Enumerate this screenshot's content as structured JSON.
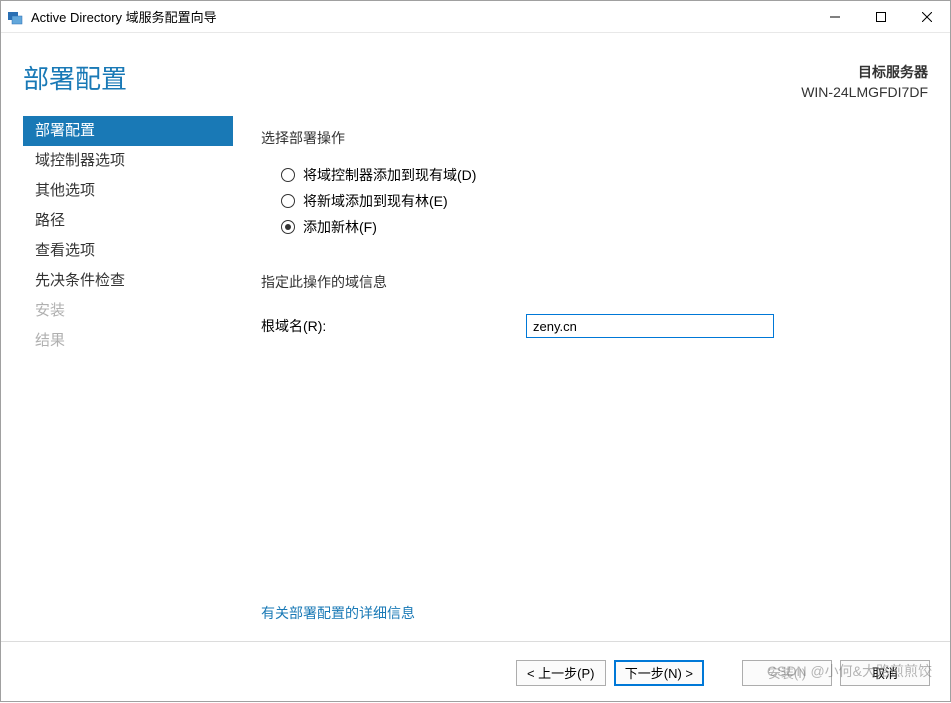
{
  "window": {
    "title": "Active Directory 域服务配置向导"
  },
  "header": {
    "page_title": "部署配置",
    "target_server_label": "目标服务器",
    "target_server_name": "WIN-24LMGFDI7DF"
  },
  "sidebar": {
    "items": [
      {
        "label": "部署配置",
        "state": "selected"
      },
      {
        "label": "域控制器选项",
        "state": "enabled"
      },
      {
        "label": "其他选项",
        "state": "enabled"
      },
      {
        "label": "路径",
        "state": "enabled"
      },
      {
        "label": "查看选项",
        "state": "enabled"
      },
      {
        "label": "先决条件检查",
        "state": "enabled"
      },
      {
        "label": "安装",
        "state": "disabled"
      },
      {
        "label": "结果",
        "state": "disabled"
      }
    ]
  },
  "main": {
    "select_op_label": "选择部署操作",
    "radios": [
      {
        "label": "将域控制器添加到现有域(D)",
        "checked": false
      },
      {
        "label": "将新域添加到现有林(E)",
        "checked": false
      },
      {
        "label": "添加新林(F)",
        "checked": true
      }
    ],
    "domain_info_label": "指定此操作的域信息",
    "root_domain_label": "根域名(R):",
    "root_domain_value": "zeny.cn",
    "help_link": "有关部署配置的详细信息"
  },
  "footer": {
    "prev": "< 上一步(P)",
    "next": "下一步(N) >",
    "install": "安装(I)",
    "cancel": "取消"
  },
  "watermark": "CSDN @小何&大路煎煎饺"
}
